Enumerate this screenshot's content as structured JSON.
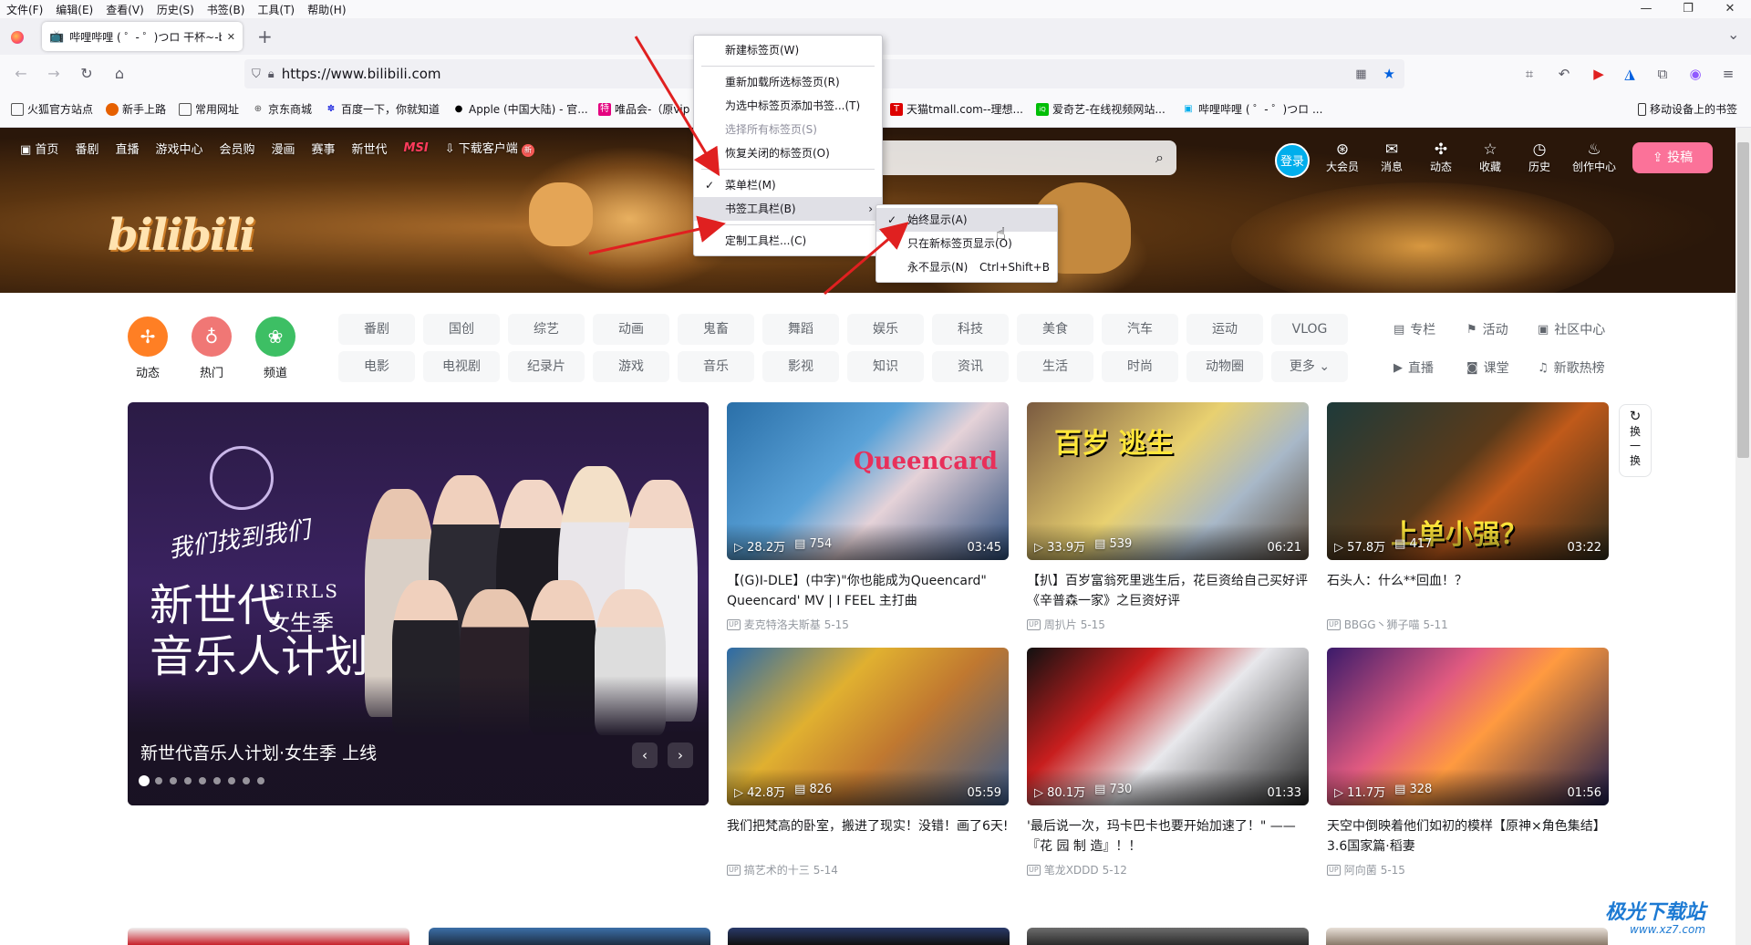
{
  "menubar": [
    "文件(F)",
    "编辑(E)",
    "查看(V)",
    "历史(S)",
    "书签(B)",
    "工具(T)",
    "帮助(H)"
  ],
  "window_controls": {
    "minimize": "—",
    "maximize": "❐",
    "close": "✕"
  },
  "tab": {
    "title": "哔哩哔哩 ( ゜- ゜)つロ 干杯~-bilibili",
    "close": "✕",
    "new_tab": "+",
    "list_all": "⌄"
  },
  "urlbar": {
    "url": "https://www.bilibili.com"
  },
  "bookmarks": [
    {
      "label": "火狐官方站点",
      "color": "#555"
    },
    {
      "label": "新手上路",
      "color": "#e66000"
    },
    {
      "label": "常用网址",
      "color": "#555"
    },
    {
      "label": "京东商城",
      "color": "#555"
    },
    {
      "label": "百度一下，你就知道",
      "color": "#2932e1"
    },
    {
      "label": "Apple (中国大陆) - 官...",
      "color": "#000"
    },
    {
      "label": "唯品会-（原vip",
      "color": "#e4007f"
    },
    {
      "label": "天猫tmall.com--理想...",
      "color": "#d00"
    },
    {
      "label": "爱奇艺-在线视频网站...",
      "color": "#00be06"
    },
    {
      "label": "哔哩哔哩 ( ゜- ゜)つロ ...",
      "color": "#00aeec"
    }
  ],
  "bookmarks_mobile": "移动设备上的书签",
  "bili_nav": {
    "left": [
      "首页",
      "番剧",
      "直播",
      "游戏中心",
      "会员购",
      "漫画",
      "赛事",
      "新世代",
      "MSI",
      "下载客户端"
    ],
    "login": "登录",
    "right": [
      {
        "label": "大会员",
        "icon": "member-icon"
      },
      {
        "label": "消息",
        "icon": "message-icon"
      },
      {
        "label": "动态",
        "icon": "dynamic-icon"
      },
      {
        "label": "收藏",
        "icon": "star-icon"
      },
      {
        "label": "历史",
        "icon": "history-icon"
      },
      {
        "label": "创作中心",
        "icon": "bulb-icon"
      }
    ],
    "upload": "投稿"
  },
  "logo": "bilibili",
  "channels": [
    {
      "label": "动态",
      "color": "#ff7f24"
    },
    {
      "label": "热门",
      "color": "#f07775"
    },
    {
      "label": "频道",
      "color": "#3dbf64"
    }
  ],
  "categories_row1": [
    "番剧",
    "国创",
    "综艺",
    "动画",
    "鬼畜",
    "舞蹈",
    "娱乐",
    "科技",
    "美食",
    "汽车",
    "运动",
    "VLOG"
  ],
  "categories_row2": [
    "电影",
    "电视剧",
    "纪录片",
    "游戏",
    "音乐",
    "影视",
    "知识",
    "资讯",
    "生活",
    "时尚",
    "动物圈",
    "更多 ⌄"
  ],
  "side_categories": [
    {
      "label": "专栏",
      "icon": "column-icon"
    },
    {
      "label": "活动",
      "icon": "flag-icon"
    },
    {
      "label": "社区中心",
      "icon": "community-icon"
    },
    {
      "label": "直播",
      "icon": "live-icon"
    },
    {
      "label": "课堂",
      "icon": "classroom-icon"
    },
    {
      "label": "新歌热榜",
      "icon": "music-chart-icon"
    }
  ],
  "carousel": {
    "caption": "新世代音乐人计划·女生季 上线",
    "big_text": "新世代\n音乐人计划",
    "girls": "GIRLS",
    "season": "女生季",
    "script": "我们找到我们",
    "dots": 9,
    "active_dot": 0
  },
  "refresh": "换一换",
  "videos": [
    {
      "views": "28.2万",
      "danmaku": "754",
      "duration": "03:45",
      "title": "【(G)I-DLE】(中字)\"你也能成为Queencard\" Queencard' MV | I FEEL 主打曲",
      "author": "麦克特洛夫斯基",
      "date": "5-15",
      "thumb_text": "Queencard"
    },
    {
      "views": "33.9万",
      "danmaku": "539",
      "duration": "06:21",
      "title": "【扒】百岁富翁死里逃生后，花巨资给自己买好评《辛普森一家》之巨资好评",
      "author": "周扒片",
      "date": "5-15",
      "thumb_text": "百岁 逃生"
    },
    {
      "views": "57.8万",
      "danmaku": "417",
      "duration": "03:22",
      "title": "石头人：什么**回血！？",
      "author": "BBGG丶狮子喵",
      "date": "5-11",
      "thumb_text": "上单小强？"
    },
    {
      "views": "42.8万",
      "danmaku": "826",
      "duration": "05:59",
      "title": "我们把梵高的卧室，搬进了现实！没错！画了6天!",
      "author": "搞艺术的十三",
      "date": "5-14",
      "thumb_text": ""
    },
    {
      "views": "80.1万",
      "danmaku": "730",
      "duration": "01:33",
      "title": "'最后说一次，玛卡巴卡也要开始加速了！\" ——『花 园 制 造』！！",
      "author": "笔龙XDDD",
      "date": "5-12",
      "thumb_text": ""
    },
    {
      "views": "11.7万",
      "danmaku": "328",
      "duration": "01:56",
      "title": "天空中倒映着他们如初的模样【原神×角色集结】3.6国家篇·稻妻",
      "author": "阿向菌",
      "date": "5-15",
      "thumb_text": ""
    }
  ],
  "context_menu": [
    {
      "label": "新建标签页(W)"
    },
    {
      "sep": true
    },
    {
      "label": "重新加载所选标签页(R)"
    },
    {
      "label": "为选中标签页添加书签...(T)"
    },
    {
      "label": "选择所有标签页(S)",
      "disabled": true
    },
    {
      "label": "恢复关闭的标签页(O)"
    },
    {
      "sep": true
    },
    {
      "label": "菜单栏(M)",
      "check": "✓"
    },
    {
      "label": "书签工具栏(B)",
      "arrow": "›",
      "highlight": true
    },
    {
      "sep": true
    },
    {
      "label": "定制工具栏...(C)"
    }
  ],
  "submenu": [
    {
      "label": "始终显示(A)",
      "check": "✓",
      "highlight": true
    },
    {
      "label": "只在新标签页显示(O)"
    },
    {
      "label": "永不显示(N)",
      "shortcut": "Ctrl+Shift+B"
    }
  ],
  "watermark": {
    "title": "极光下载站",
    "url": "www.xz7.com"
  },
  "colors": {
    "accent_pink": "#fb7299",
    "accent_blue": "#00aeec",
    "arrow_red": "#e02020"
  }
}
